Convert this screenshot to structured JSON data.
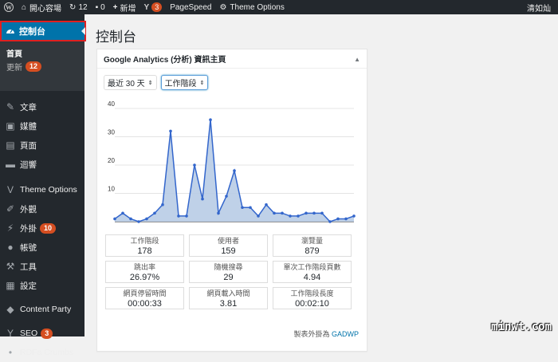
{
  "adminbar": {
    "site_name": "開心容場",
    "updates_count": "12",
    "comments_count": "0",
    "new_label": "新增",
    "seo_badge": "3",
    "pagespeed": "PageSpeed",
    "theme_options": "Theme Options",
    "user": "清如灿"
  },
  "sidebar": {
    "active": "控制台",
    "sub_home": "首頁",
    "sub_updates": "更新",
    "sub_updates_badge": "12",
    "items": [
      {
        "label": "文章",
        "icon": "pin-icon"
      },
      {
        "label": "媒體",
        "icon": "media-icon"
      },
      {
        "label": "頁面",
        "icon": "page-icon"
      },
      {
        "label": "迴響",
        "icon": "comment-icon"
      },
      {
        "label": "Theme Options",
        "icon": "v-icon"
      },
      {
        "label": "外觀",
        "icon": "brush-icon"
      },
      {
        "label": "外掛",
        "icon": "plugin-icon",
        "badge": "10"
      },
      {
        "label": "帳號",
        "icon": "user-icon"
      },
      {
        "label": "工具",
        "icon": "wrench-icon"
      },
      {
        "label": "設定",
        "icon": "settings-icon"
      },
      {
        "label": "Content Party",
        "icon": "cp-icon"
      },
      {
        "label": "SEO",
        "icon": "yoast-icon",
        "badge": "3"
      },
      {
        "label": "RDFa Crumbs",
        "icon": "dot-icon"
      }
    ]
  },
  "main": {
    "title": "控制台",
    "widget_title": "Google Analytics (分析) 資訊主頁",
    "range_select": "最近 30 天",
    "metric_select": "工作階段",
    "credit_text": "製表外掛為",
    "credit_link": "GADWP"
  },
  "stats": [
    {
      "label": "工作階段",
      "value": "178"
    },
    {
      "label": "使用者",
      "value": "159"
    },
    {
      "label": "瀏覽量",
      "value": "879"
    },
    {
      "label": "跳出率",
      "value": "26.97%"
    },
    {
      "label": "隨機搜尋",
      "value": "29"
    },
    {
      "label": "單次工作階段頁數",
      "value": "4.94"
    },
    {
      "label": "網頁停留時間",
      "value": "00:00:33"
    },
    {
      "label": "網頁載入時間",
      "value": "3.81"
    },
    {
      "label": "工作階段長度",
      "value": "00:02:10"
    }
  ],
  "chart_data": {
    "type": "area",
    "ylim": [
      0,
      40
    ],
    "yticks": [
      10,
      20,
      30,
      40
    ],
    "values": [
      1,
      3,
      1,
      0,
      1,
      3,
      6,
      32,
      2,
      2,
      20,
      8,
      36,
      3,
      9,
      18,
      5,
      5,
      2,
      6,
      3,
      3,
      2,
      2,
      3,
      3,
      3,
      0,
      1,
      1,
      2
    ],
    "color": "#3366cc",
    "fill": "#b8cce6"
  },
  "watermark": "minwt.com"
}
